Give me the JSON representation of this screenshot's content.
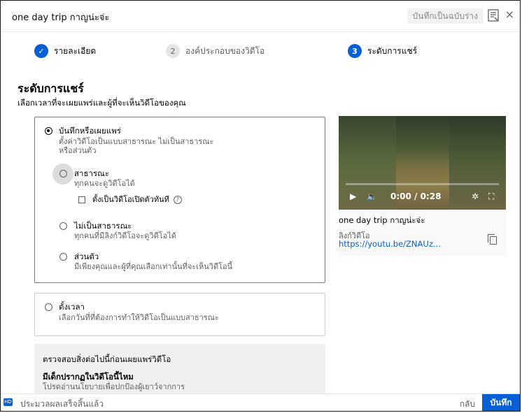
{
  "header": {
    "title": "one day trip กาญน่ะจ่ะ",
    "save_draft": "บันทึกเป็นฉบับร่าง",
    "close": "×"
  },
  "stepper": {
    "steps": [
      {
        "num": "✓",
        "label": "รายละเอียด"
      },
      {
        "num": "2",
        "label": "องค์ประกอบของวิดีโอ"
      },
      {
        "num": "3",
        "label": "ระดับการแชร์"
      }
    ]
  },
  "main": {
    "title": "ระดับการแชร์",
    "subtitle": "เลือกเวลาที่จะเผยแพร่และผู้ที่จะเห็นวิดีโอของคุณ",
    "save_publish": {
      "title": "บันทึกหรือเผยแพร่",
      "desc1": "ตั้งค่าวิดีโอเป็นแบบสาธารณะ ไม่เป็นสาธารณะ",
      "desc2": "หรือส่วนตัว"
    },
    "public": {
      "title": "สาธารณะ",
      "desc": "ทุกคนจะดูวิดีโอได้"
    },
    "premiere": {
      "label": "ตั้งเป็นวิดีโอเปิดตัวทันที",
      "help": "?"
    },
    "unlisted": {
      "title": "ไม่เป็นสาธารณะ",
      "desc": "ทุกคนที่มีลิงก์วิดีโอจะดูวิดีโอได้"
    },
    "private": {
      "title": "ส่วนตัว",
      "desc": "มีเพียงคุณและผู้ที่คุณเลือกเท่านั้นที่จะเห็นวิดีโอนี้"
    },
    "schedule": {
      "title": "ตั้งเวลา",
      "desc": "เลือกวันที่ที่ต้องการทำให้วิดีโอเป็นแบบสาธารณะ"
    },
    "checklist": {
      "title": "ตรวจสอบสิ่งต่อไปนี้ก่อนเผยแพร่วิดีโอ",
      "q": "มีเด็กปรากฏในวิดีโอนี้ไหม",
      "desc": "โปรดอ่านนโยบายเพื่อปกป้องผู้เยาว์จากการ"
    }
  },
  "video": {
    "time": "0:00 / 0:28",
    "title": "one day trip กาญน่ะจ่ะ",
    "link_label": "ลิงก์วิดีโอ",
    "link": "https://youtu.be/ZNAUz..."
  },
  "footer": {
    "status": "ประมวลผลเสร็จสิ้นแล้ว",
    "back": "กลับ",
    "save": "บันทึก"
  }
}
